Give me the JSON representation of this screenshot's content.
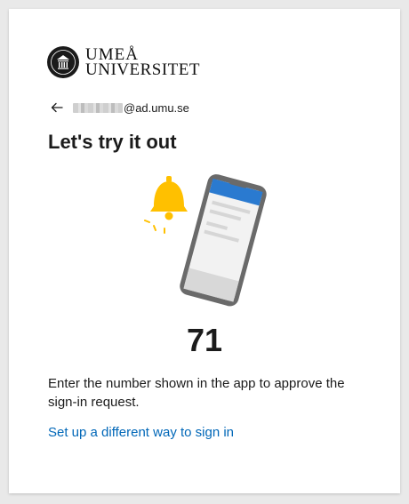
{
  "logo": {
    "line1": "UMEÅ",
    "line2": "UNIVERSITET"
  },
  "identity": {
    "domain_suffix": "@ad.umu.se"
  },
  "title": "Let's try it out",
  "code": "71",
  "description": "Enter the number shown in the app to approve the sign-in request.",
  "alt_link": "Set up a different way to sign in",
  "colors": {
    "accent_link": "#0067b8",
    "bell": "#ffc000",
    "phone_header": "#2a7ad0",
    "phone_frame": "#6a6a6a"
  }
}
